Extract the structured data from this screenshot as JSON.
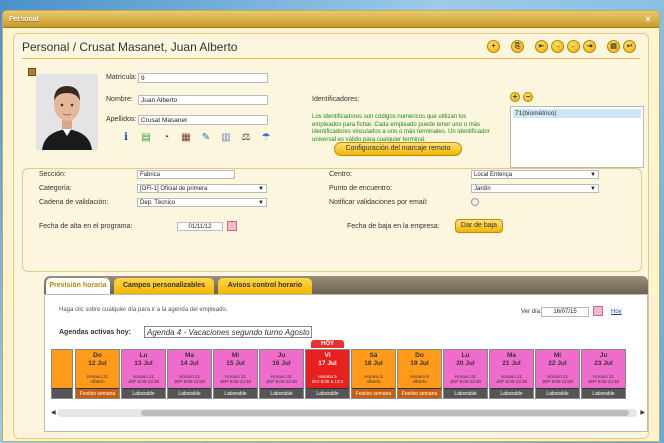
{
  "window": {
    "title": "Personal",
    "close": "×"
  },
  "header": {
    "title": "Personal / Crusat Masanet, Juan Alberto"
  },
  "toolbar": {
    "buttons": [
      "+",
      "⎘",
      "⇤",
      "→",
      "←",
      "⇥",
      "▤",
      "↩"
    ]
  },
  "employee": {
    "matricula_label": "Matrícula:",
    "matricula": "9",
    "nombre_label": "Nombre:",
    "nombre": "Juan Alberto",
    "apellidos_label": "Apellidos:",
    "apellidos": "Crusat Masanet"
  },
  "identifiers": {
    "title": "Identificadores:",
    "description": "Los identificadores son códigos numéricos que utilizan los empleados para fichar. Cada empleado puede tener uno o más identificadores vinculados a uno o más terminales. Un identificador universal es válido para cualquier terminal.",
    "config_button": "Configuración del marcaje remoto",
    "list": [
      "71(biométrico)"
    ]
  },
  "form": {
    "seccion_label": "Sección:",
    "seccion": "Fabrica",
    "categoria_label": "Categoría:",
    "categoria": "[OFI-1] Oficial de primera",
    "cadena_label": "Cadena de validación:",
    "cadena": "Dep. Técnico",
    "centro_label": "Centro:",
    "centro": "Local Entença",
    "punto_label": "Punto de encuentro:",
    "punto": "Jardín",
    "notificar_label": "Notificar validaciones por email:",
    "alta_label": "Fecha de alta en el programa:",
    "alta": "01/11/12",
    "baja_label": "Fecha de baja en la empresa:",
    "baja_button": "Dar de baja"
  },
  "tabs": [
    {
      "label": "Previsión horaria"
    },
    {
      "label": "Campos personalizables"
    },
    {
      "label": "Avisos control horario"
    }
  ],
  "prevision": {
    "hint": "Haga clic sobre cualquier día para ir a la agenda del empleado.",
    "ver_dia_label": "Ver día:",
    "ver_dia": "16/07/15",
    "hoy_link": "Hoy",
    "agendas_label": "Agendas activas hoy:",
    "agendas_value": "Agenda 4 - Vacaciones segundo turno Agosto",
    "hoy_badge": "HOY",
    "days": [
      {
        "head": "",
        "sub": "",
        "mid": "",
        "foot": "",
        "color": "#ff9a1a"
      },
      {
        "head": "Do",
        "sub": "12 Jul",
        "mid": "Horario 21\nAlberto",
        "foot": "Festivo semana",
        "color": "#ff9a1a"
      },
      {
        "head": "Lu",
        "sub": "13 Jul",
        "mid": "Horario 21\nJEP 9:00-13:30",
        "foot": "Laborable",
        "color": "#f06ccc"
      },
      {
        "head": "Ma",
        "sub": "14 Jul",
        "mid": "Horario 21\nJEP 9:00-13:30",
        "foot": "Laborable",
        "color": "#f06ccc"
      },
      {
        "head": "Mi",
        "sub": "15 Jul",
        "mid": "Horario 21\nJEP 9:00-13:30",
        "foot": "Laborable",
        "color": "#f06ccc"
      },
      {
        "head": "Ju",
        "sub": "16 Jul",
        "mid": "Horario 21\nJEP 9:00-13:30",
        "foot": "Laborable",
        "color": "#f06ccc"
      },
      {
        "head": "Vi",
        "sub": "17 Jul",
        "mid": "Horario 5\nDIV 8:00 a 13:3",
        "foot": "Laborable",
        "color": "#e82020"
      },
      {
        "head": "Sá",
        "sub": "18 Jul",
        "mid": "Horario 5\nAlberto",
        "foot": "Festivo semana",
        "color": "#ff9a1a"
      },
      {
        "head": "Do",
        "sub": "19 Jul",
        "mid": "Horario 5\nAlberto",
        "foot": "Festivo semana",
        "color": "#ff9a1a"
      },
      {
        "head": "Lu",
        "sub": "20 Jul",
        "mid": "Horario 21\nJEP 9:00-13:30",
        "foot": "Laborable",
        "color": "#f06ccc"
      },
      {
        "head": "Ma",
        "sub": "21 Jul",
        "mid": "Horario 21\nJEP 9:00-13:30",
        "foot": "Laborable",
        "color": "#f06ccc"
      },
      {
        "head": "Mi",
        "sub": "22 Jul",
        "mid": "Horario 21\nJEP 9:00-13:30",
        "foot": "Laborable",
        "color": "#f06ccc"
      },
      {
        "head": "Ju",
        "sub": "23 Jul",
        "mid": "Horario 21\nJEP 9:00-13:30",
        "foot": "Laborable",
        "color": "#f06ccc"
      }
    ]
  },
  "colors": {
    "accent": "#f4b400",
    "today": "#e82020",
    "weekend": "#ff9a1a",
    "workday": "#f06ccc"
  }
}
